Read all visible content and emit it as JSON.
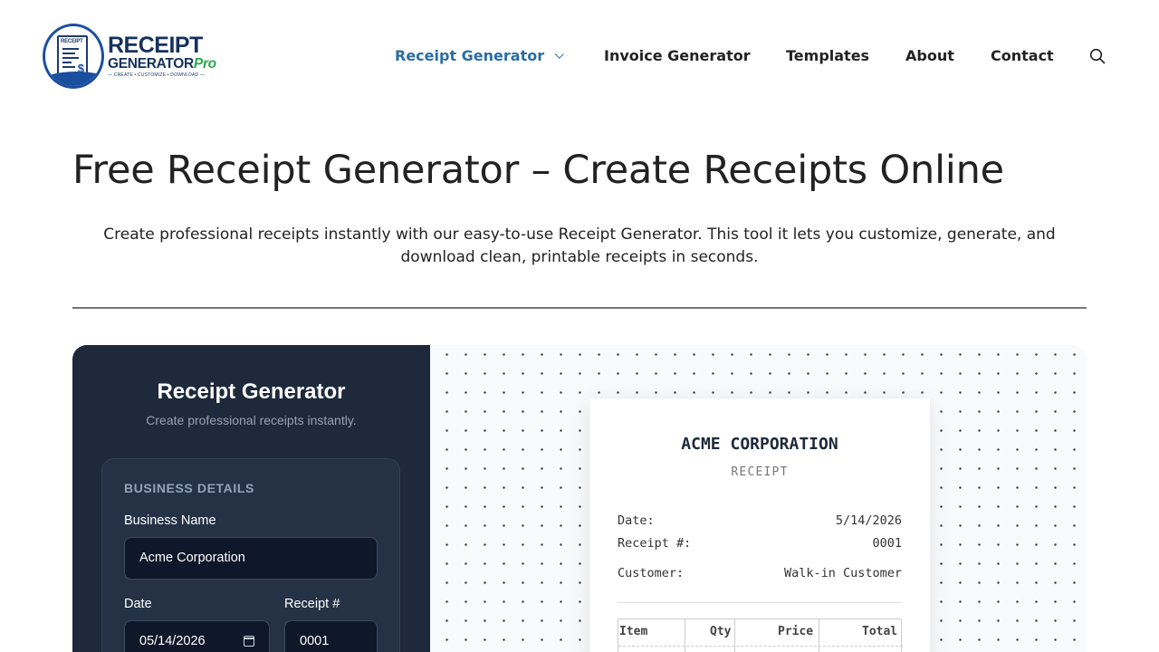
{
  "logo": {
    "doc_tag": "RECEIPT",
    "line1": "RECEIPT",
    "line2": "GENERATOR",
    "line2_accent": "Pro",
    "tagline": "— CREATE • CUSTOMIZE • DOWNLOAD —"
  },
  "nav": {
    "items": [
      {
        "label": "Receipt Generator",
        "active": true,
        "has_dropdown": true
      },
      {
        "label": "Invoice Generator"
      },
      {
        "label": "Templates"
      },
      {
        "label": "About"
      },
      {
        "label": "Contact"
      }
    ],
    "search_icon": "search-icon"
  },
  "hero": {
    "title": "Free Receipt Generator – Create Receipts Online",
    "intro": "Create professional receipts instantly with our easy-to-use Receipt Generator. This tool it lets you customize, generate, and download clean, printable receipts in seconds."
  },
  "app": {
    "title": "Receipt Generator",
    "subtitle": "Create professional receipts instantly.",
    "section_label": "BUSINESS DETAILS",
    "fields": {
      "business_name_label": "Business Name",
      "business_name_value": "Acme Corporation",
      "date_label": "Date",
      "date_value": "05/14/2026",
      "receipt_no_label": "Receipt #",
      "receipt_no_value": "0001"
    }
  },
  "receipt": {
    "company": "ACME CORPORATION",
    "kind": "RECEIPT",
    "rows": [
      {
        "key": "Date:",
        "value": "5/14/2026"
      },
      {
        "key": "Receipt #:",
        "value": "0001"
      },
      {
        "key": "Customer:",
        "value": "Walk-in Customer"
      }
    ],
    "columns": [
      "Item",
      "Qty",
      "Price",
      "Total"
    ]
  },
  "colors": {
    "accent": "#2b6ca3",
    "sidebar_bg": "#1e293b",
    "card_bg": "#253246",
    "input_bg": "#0f172a",
    "logo_blue": "#1a4fa0",
    "logo_green": "#2aa84a"
  }
}
